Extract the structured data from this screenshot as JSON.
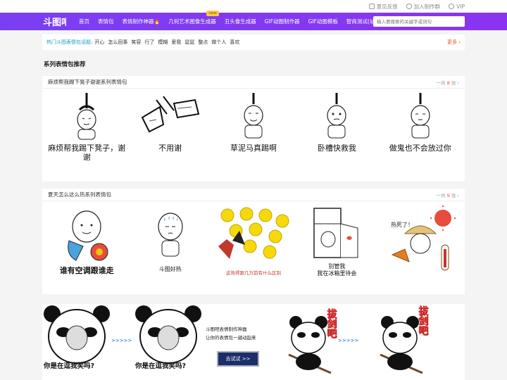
{
  "topbar": {
    "feedback": "意见反馈",
    "join": "加入制作群",
    "vip": "VIP"
  },
  "nav": {
    "logo_text": "斗图吧",
    "items": [
      {
        "label": "首页"
      },
      {
        "label": "表情包"
      },
      {
        "label": "表情制作神器",
        "flame": "🔥"
      },
      {
        "label": "几何艺术图像生成器",
        "badge": "new"
      },
      {
        "label": "丑头像生成器"
      },
      {
        "label": "GIF动图制作器"
      },
      {
        "label": "GIF动图模板"
      },
      {
        "label": "智商测试(站外)"
      }
    ],
    "search_placeholder": "输入要搜索的关键字或词句"
  },
  "hot": {
    "title": "热门斗图表情包话题:",
    "tags": [
      "开心",
      "怎么回事",
      "笑容",
      "行了",
      "模糊",
      "爱我",
      "鼠鼠",
      "整点",
      "做个人",
      "喜欢"
    ],
    "more": "更多"
  },
  "section_title": "系列表情包推荐",
  "series": [
    {
      "title": "麻烦帮我踢下凳子谢谢系列表情包",
      "count_prefix": "一共",
      "count": "8",
      "count_suffix": "张",
      "memes": [
        {
          "caption": "麻烦帮我踢下凳子，谢谢"
        },
        {
          "caption": "不用谢"
        },
        {
          "caption": "草泥马真踢啊"
        },
        {
          "caption": "卧槽快救我"
        },
        {
          "caption": "做鬼也不会放过你"
        }
      ]
    },
    {
      "title": "夏天怎么这么热系列表情包",
      "count_prefix": "一共",
      "count": "9",
      "count_suffix": "张",
      "memes": [
        {
          "caption": "谁有空调跟谁走"
        },
        {
          "caption": "斗图好热"
        },
        {
          "caption": "这热得跟几万前有什么区别"
        },
        {
          "caption": "别管我\n我在冰箱里待会"
        },
        {
          "caption": "热死了！"
        }
      ]
    }
  ],
  "banner": {
    "line1": "斗图吧表情制作神器",
    "line2": "让你的表情包一键动起来",
    "button": "去试试 >>",
    "arrows": ">>>>>",
    "panda_caption": "你是在逗我笑吗?",
    "slash_text": "拔剑吧"
  },
  "colors": {
    "nav_bg": "#7b3ff2",
    "accent_orange": "#e05a2b",
    "hot_title": "#1aa0c8"
  }
}
